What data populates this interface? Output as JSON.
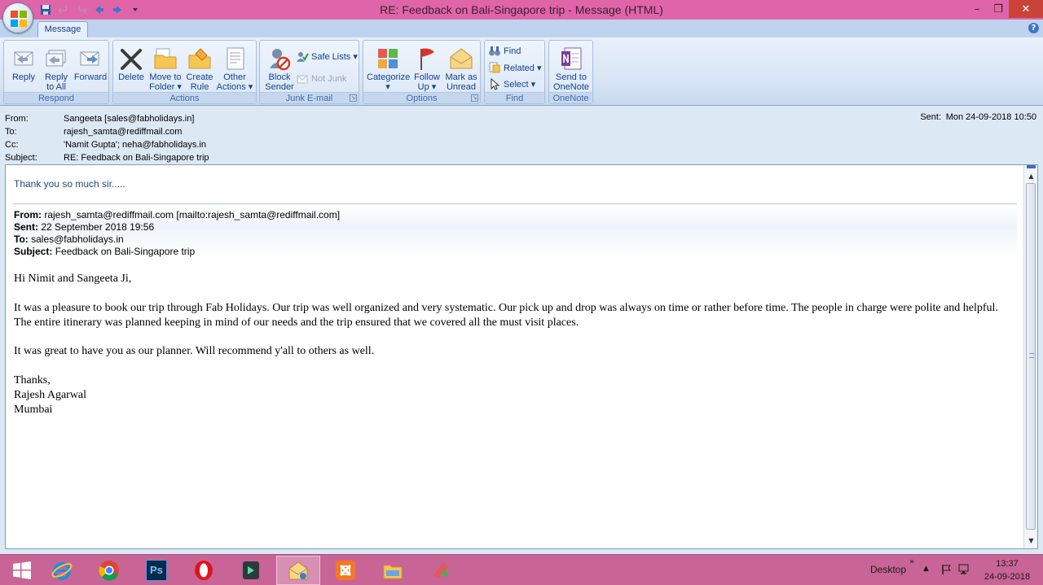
{
  "window": {
    "title": "RE: Feedback on Bali-Singapore trip - Message (HTML)",
    "close_glyph": "✕",
    "minimize_glyph": "–",
    "restore_glyph": "❐"
  },
  "ribbon": {
    "tab": "Message",
    "help": "?",
    "groups": {
      "respond": "Respond",
      "actions": "Actions",
      "junk": "Junk E-mail",
      "options": "Options",
      "find": "Find",
      "onenote": "OneNote"
    },
    "buttons": {
      "reply": "Reply",
      "reply_all": "Reply\nto All",
      "forward": "Forward",
      "delete": "Delete",
      "move_to_folder": "Move to\nFolder ▾",
      "create_rule": "Create\nRule",
      "other_actions": "Other\nActions ▾",
      "block_sender": "Block\nSender",
      "safe_lists": "Safe Lists ▾",
      "not_junk": "Not Junk",
      "categorize": "Categorize\n▾",
      "follow_up": "Follow\nUp ▾",
      "mark_as_unread": "Mark as\nUnread",
      "find": "Find",
      "related": "Related ▾",
      "select": "Select ▾",
      "send_to_onenote": "Send to\nOneNote"
    }
  },
  "header": {
    "from_label": "From:",
    "from_value": "Sangeeta [sales@fabholidays.in]",
    "to_label": "To:",
    "to_value": "rajesh_samta@rediffmail.com",
    "cc_label": "Cc:",
    "cc_value": "'Namit Gupta'; neha@fabholidays.in",
    "subject_label": "Subject:",
    "subject_value": "RE: Feedback on Bali-Singapore trip",
    "sent_label": "Sent:",
    "sent_value": "Mon 24-09-2018 10:50"
  },
  "body": {
    "reply_text": "Thank you so much sir.....",
    "original": {
      "from_label": "From:",
      "from_value": "rajesh_samta@rediffmail.com [mailto:rajesh_samta@rediffmail.com]",
      "sent_label": "Sent:",
      "sent_value": "22 September 2018 19:56",
      "to_label": "To:",
      "to_value": "sales@fabholidays.in",
      "subject_label": "Subject:",
      "subject_value": "Feedback on Bali-Singapore trip"
    },
    "greeting": "Hi Nimit and Sangeeta Ji,",
    "paragraph1": "It was a pleasure to book our trip through Fab Holidays. Our trip was well organized and very systematic. Our pick up and drop was always on time or rather before time. The people in charge were polite and helpful. The entire itinerary was planned keeping in mind of our needs and the trip ensured that we covered all the must visit places.",
    "paragraph2": "It was great to have you as our planner. Will recommend y'all to others as well.",
    "closing": "Thanks,",
    "signature_name": "Rajesh Agarwal",
    "signature_city": "Mumbai"
  },
  "taskbar": {
    "items": [
      "start-icon",
      "internet-explorer-icon",
      "chrome-icon",
      "photoshop-icon",
      "opera-icon",
      "filmora-icon",
      "outlook-icon",
      "xampp-icon",
      "file-explorer-icon",
      "app-icon"
    ],
    "photoshop_label": "Ps",
    "desktop_label": "Desktop",
    "chevron": "»",
    "tray_up": "▲",
    "time": "13:37",
    "date": "24-09-2018"
  },
  "colors": {
    "title_bar": "#e064a8",
    "taskbar": "#c86496",
    "ribbon_text": "#15428b",
    "reply_text": "#1f497d"
  }
}
